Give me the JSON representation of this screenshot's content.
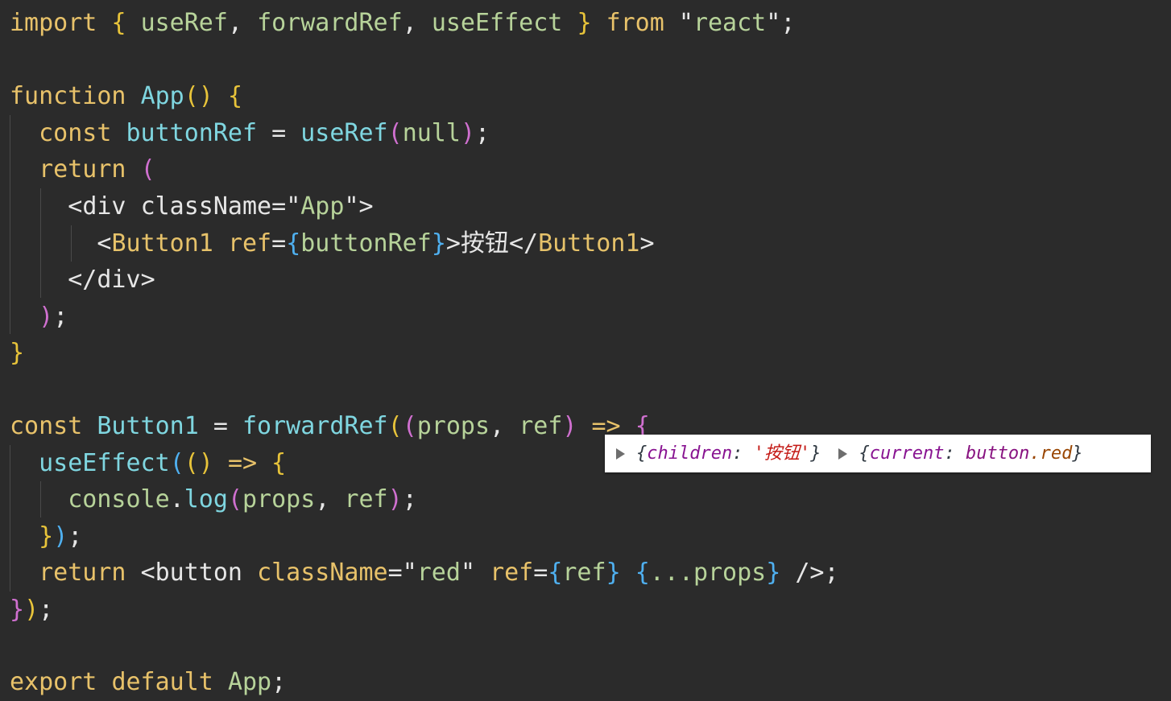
{
  "code": {
    "import_kw": "import",
    "import_names": [
      "useRef",
      "forwardRef",
      "useEffect"
    ],
    "from_kw": "from",
    "module": "react",
    "function_kw": "function",
    "app_name": "App",
    "const_kw": "const",
    "button_ref_var": "buttonRef",
    "use_ref_fn": "useRef",
    "null_literal": "null",
    "return_kw": "return",
    "div_tag": "div",
    "classname_attr": "className",
    "app_class": "App",
    "button1_tag": "Button1",
    "ref_attr": "ref",
    "button_text": "按钮",
    "button1_name": "Button1",
    "forward_ref_fn": "forwardRef",
    "props_param": "props",
    "ref_param": "ref",
    "use_effect_fn": "useEffect",
    "console_obj": "console",
    "log_fn": "log",
    "button_tag": "button",
    "red_class": "red",
    "export_kw": "export",
    "default_kw": "default"
  },
  "console_popup": {
    "items": [
      {
        "key": "children",
        "value": "按钮"
      },
      {
        "key": "current",
        "node": "button",
        "cls": ".red"
      }
    ]
  }
}
